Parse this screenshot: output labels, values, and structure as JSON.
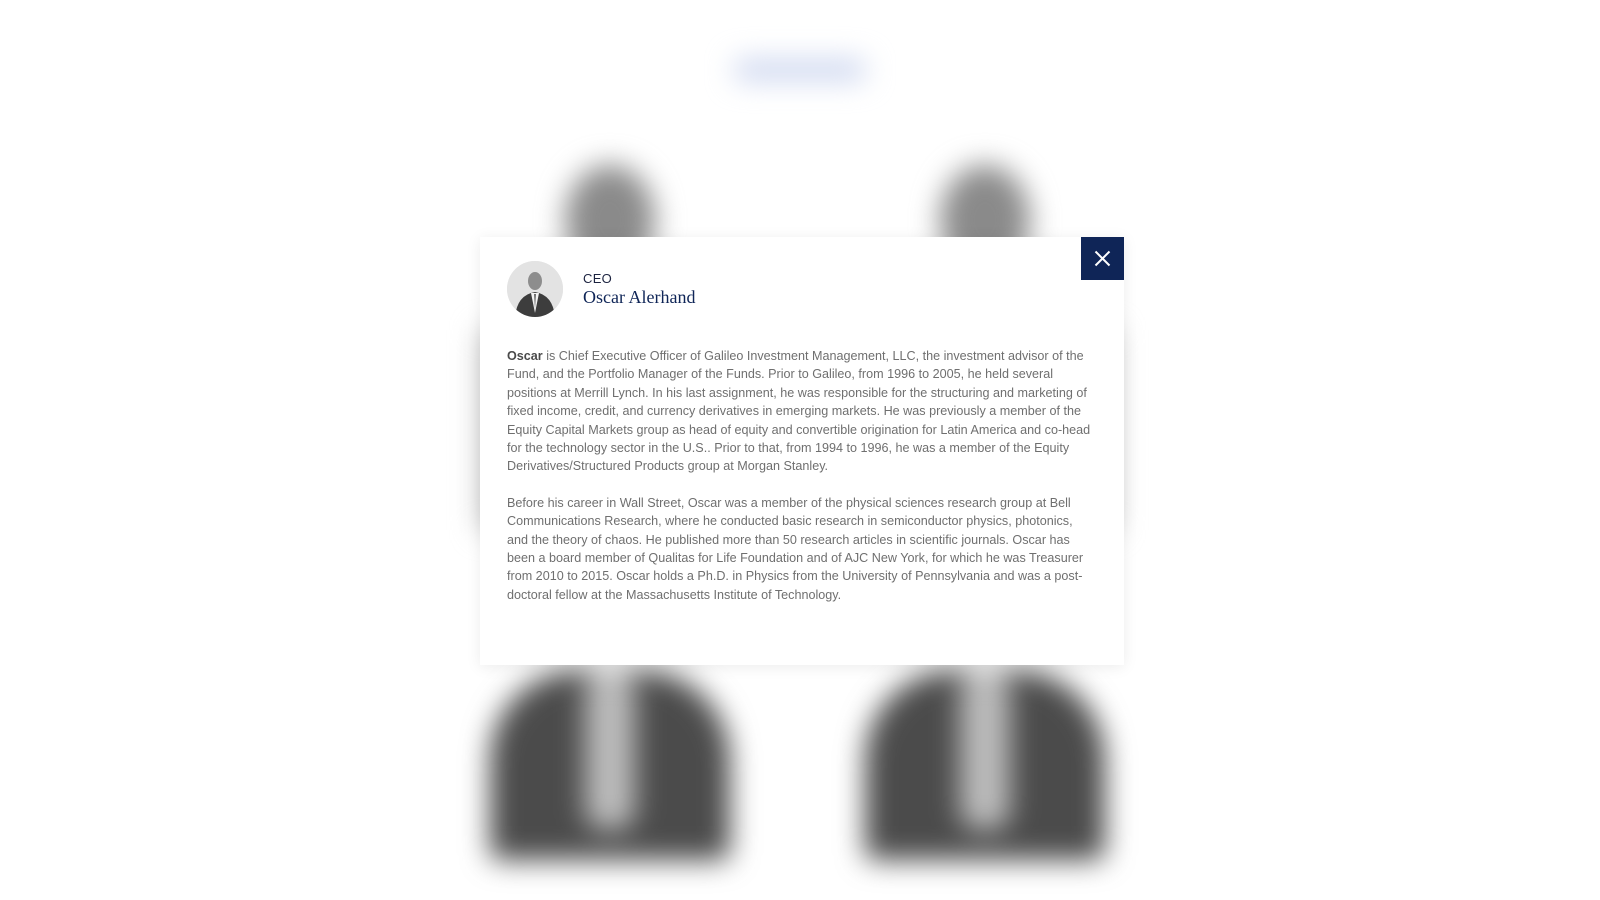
{
  "modal": {
    "role": "CEO",
    "name": "Oscar Alerhand",
    "close_label": "close",
    "bio": {
      "p1_lead": "Oscar",
      "p1_rest": " is Chief Executive Officer of Galileo Investment Management, LLC, the investment advisor of the Fund, and the Portfolio Manager of the Funds.  Prior to Galileo, from 1996 to 2005, he held several positions at Merrill Lynch.  In his last assignment, he was responsible for the structuring and marketing of fixed income, credit, and currency derivatives in emerging markets.  He was previously a member of the Equity Capital Markets group as head of equity and convertible origination for Latin America and co-head for the technology sector in the U.S..  Prior to that, from 1994 to 1996, he was a member of the Equity Derivatives/Structured Products group at Morgan Stanley.",
      "p2": "Before his career in Wall Street, Oscar was a member of the physical sciences research group at Bell Communications Research, where he conducted basic research in semiconductor physics, photonics, and the theory of chaos. He published more than 50 research articles in scientific journals.  Oscar has been a board member of Qualitas for Life Foundation and of AJC New York, for which he was Treasurer from 2010 to 2015. Oscar holds a Ph.D. in Physics from the University of Pennsylvania and was a post-doctoral fellow at the Massachusetts Institute of Technology."
    }
  },
  "colors": {
    "accent": "#0f2557",
    "body_text": "#6f6f6f"
  },
  "icons": {
    "close": "close-icon"
  }
}
